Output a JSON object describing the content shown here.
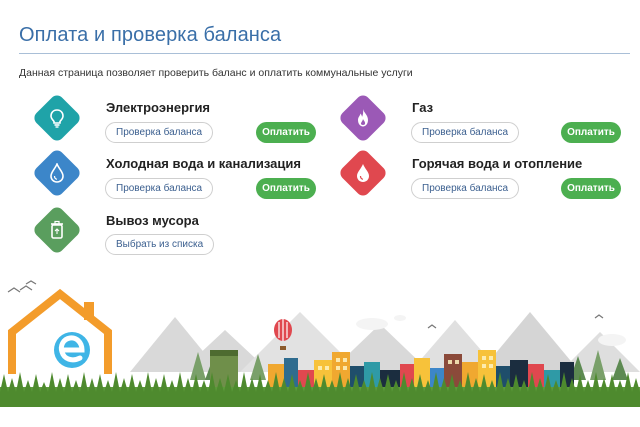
{
  "page": {
    "title": "Оплата и проверка баланса",
    "description": "Данная страница позволяет проверить баланс и оплатить коммунальные услуги"
  },
  "services": [
    {
      "name": "Электроэнергия",
      "icon": "lightbulb-icon",
      "color": "#1fa3a8",
      "check_label": "Проверка баланса",
      "pay_label": "Оплатить"
    },
    {
      "name": "Газ",
      "icon": "gas-flame-icon",
      "color": "#9b59b6",
      "check_label": "Проверка баланса",
      "pay_label": "Оплатить"
    },
    {
      "name": "Холодная вода и канализация",
      "icon": "water-drop-icon",
      "color": "#3c86c9",
      "check_label": "Проверка баланса",
      "pay_label": "Оплатить"
    },
    {
      "name": "Горячая вода и отопление",
      "icon": "hot-water-drop-icon",
      "color": "#e0484f",
      "check_label": "Проверка баланса",
      "pay_label": "Оплатить"
    },
    {
      "name": "Вывоз мусора",
      "icon": "trash-bin-icon",
      "color": "#5a9e5e",
      "select_label": "Выбрать из списка"
    }
  ],
  "colors": {
    "accent": "#3a6fa8",
    "pay_button": "#4caf50"
  }
}
